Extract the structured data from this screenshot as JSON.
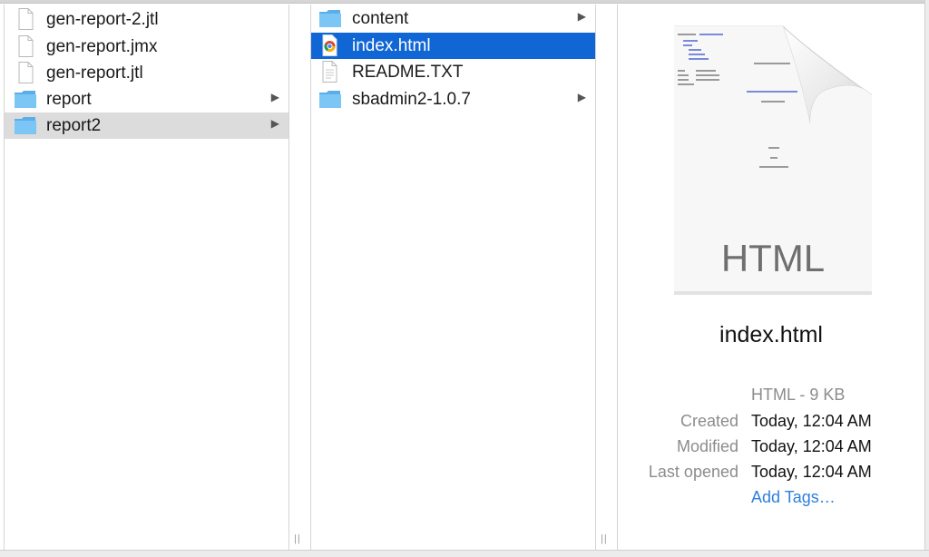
{
  "column1": {
    "items": [
      {
        "name": "gen-report-2.jtl",
        "kind": "file"
      },
      {
        "name": "gen-report.jmx",
        "kind": "file"
      },
      {
        "name": "gen-report.jtl",
        "kind": "file"
      },
      {
        "name": "report",
        "kind": "folder",
        "chevron": "▶"
      },
      {
        "name": "report2",
        "kind": "folder",
        "chevron": "▶",
        "selected": true
      }
    ]
  },
  "column2": {
    "items": [
      {
        "name": "content",
        "kind": "folder",
        "chevron": "▶"
      },
      {
        "name": "index.html",
        "kind": "html",
        "selected": true
      },
      {
        "name": "README.TXT",
        "kind": "file"
      },
      {
        "name": "sbadmin2-1.0.7",
        "kind": "folder",
        "chevron": "▶"
      }
    ]
  },
  "preview": {
    "filename": "index.html",
    "type_label": "HTML",
    "kind_size": "HTML - 9 KB",
    "created_label": "Created",
    "created_value": "Today, 12:04 AM",
    "modified_label": "Modified",
    "modified_value": "Today, 12:04 AM",
    "opened_label": "Last opened",
    "opened_value": "Today, 12:04 AM",
    "add_tags": "Add Tags…"
  },
  "colors": {
    "selection_blue": "#1166d6",
    "selection_gray": "#dcdcdc",
    "folder_blue": "#6fbef2",
    "link_blue": "#2d7fe0"
  },
  "resize_grip": "||"
}
